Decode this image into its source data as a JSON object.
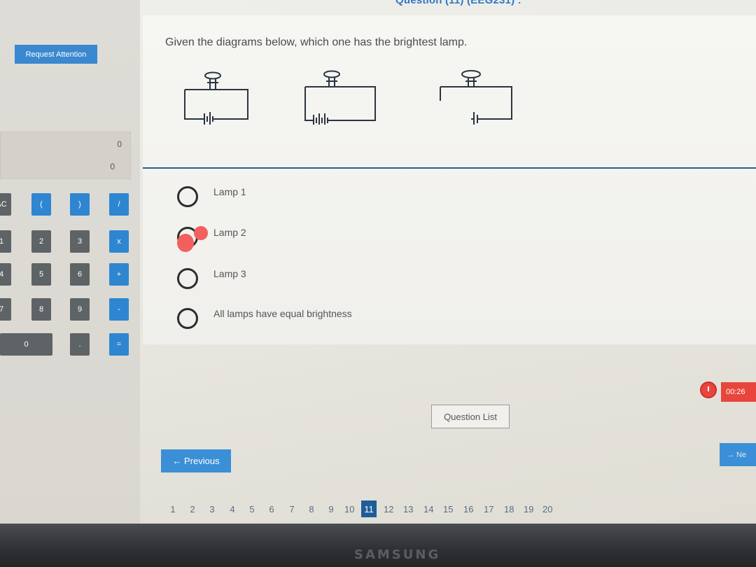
{
  "header": {
    "question_title": "Question (11) (EEG231) :"
  },
  "sidebar": {
    "request_attention": "Request Attention",
    "calculator": {
      "display_line1": "0",
      "display_line2": "0",
      "keys": {
        "ac": "AC",
        "open_paren": "(",
        "close_paren": ")",
        "divide": "/",
        "one": "1",
        "two": "2",
        "three": "3",
        "multiply": "x",
        "four": "4",
        "five": "5",
        "six": "6",
        "plus": "+",
        "seven": "7",
        "eight": "8",
        "nine": "9",
        "minus": "-",
        "zero": "0",
        "dot": ".",
        "equals": "="
      }
    }
  },
  "question": {
    "text": "Given the diagrams below, which one has the brightest lamp.",
    "options": [
      {
        "label": "Lamp 1",
        "selected": false
      },
      {
        "label": "Lamp 2",
        "selected": true
      },
      {
        "label": "Lamp 3",
        "selected": false
      },
      {
        "label": "All lamps have equal brightness",
        "selected": false
      }
    ]
  },
  "timer": {
    "value": "00:26"
  },
  "nav": {
    "question_list": "Question List",
    "previous": "← Previous",
    "next": "→ Ne"
  },
  "pager": {
    "pages": [
      "1",
      "2",
      "3",
      "4",
      "5",
      "6",
      "7",
      "8",
      "9",
      "10",
      "11",
      "12",
      "13",
      "14",
      "15",
      "16",
      "17",
      "18",
      "19",
      "20"
    ],
    "current": "11"
  },
  "device": {
    "brand": "SAMSUNG"
  },
  "colors": {
    "accent": "#2e86d1",
    "timer": "#e8453c",
    "selection": "#f25f5c",
    "active_page": "#1f5d99"
  }
}
